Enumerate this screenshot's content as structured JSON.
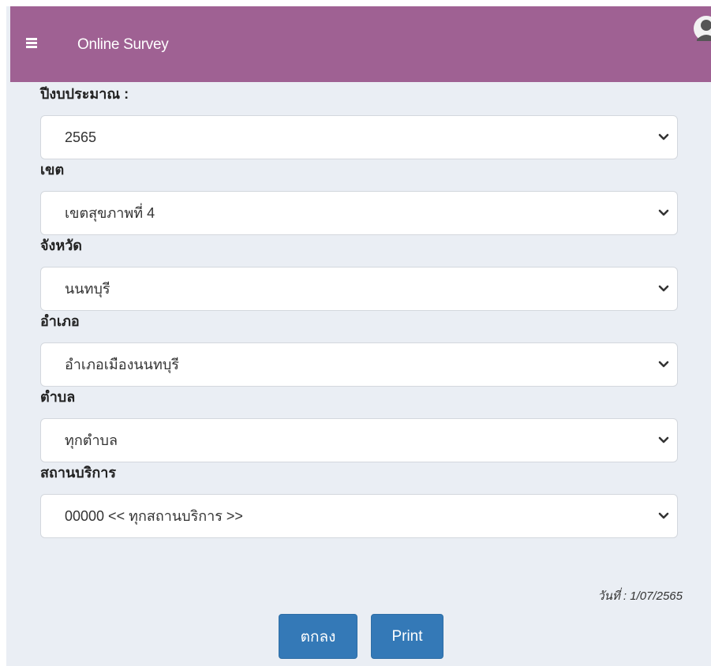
{
  "header": {
    "menu_icon": "hamburger-menu-icon",
    "title": "Online Survey",
    "avatar_icon": "user-avatar-icon"
  },
  "form": {
    "fields": [
      {
        "label": "ปีงบประมาณ :",
        "value": "2565"
      },
      {
        "label": "เขต",
        "value": "เขตสุขภาพที่ 4"
      },
      {
        "label": "จังหวัด",
        "value": "นนทบุรี"
      },
      {
        "label": "อำเภอ",
        "value": "อำเภอเมืองนนทบุรี"
      },
      {
        "label": "ตำบล",
        "value": "ทุกตำบล"
      },
      {
        "label": "สถานบริการ",
        "value": "00000 << ทุกสถานบริการ >>"
      }
    ]
  },
  "date_text": "วันที่ : 1/07/2565",
  "buttons": {
    "ok_label": "ตกลง",
    "print_label": "Print"
  },
  "colors": {
    "navbar": "#9f6193",
    "button": "#3479b7",
    "background": "#eaeef4"
  }
}
